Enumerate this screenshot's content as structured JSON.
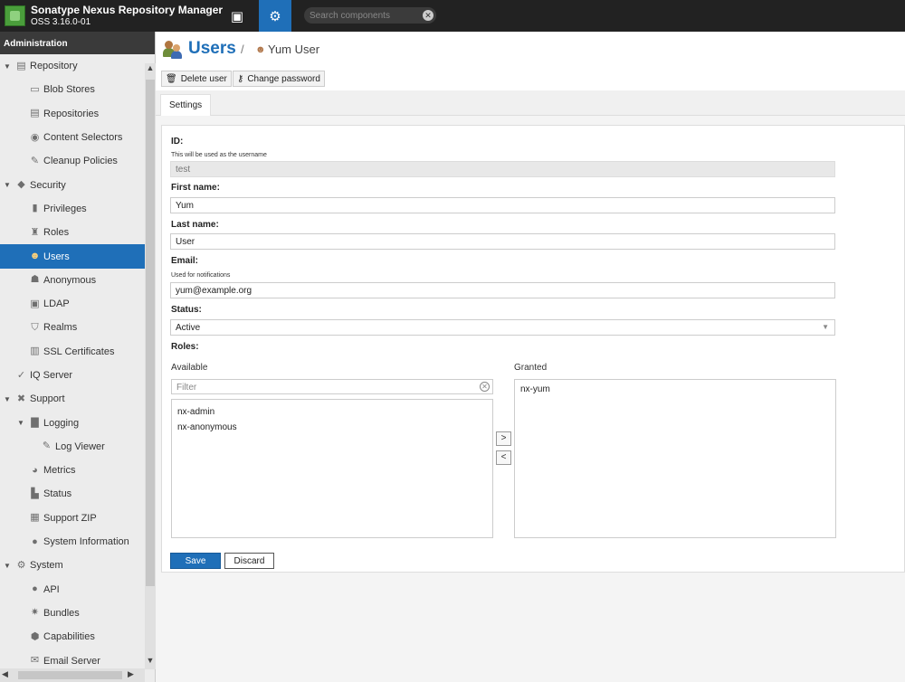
{
  "header": {
    "app_title": "Sonatype Nexus Repository Manager",
    "app_version": "OSS 3.16.0-01",
    "search_placeholder": "Search components",
    "search_clear": "✕"
  },
  "sidebar": {
    "title": "Administration",
    "items": [
      {
        "label": "Repository",
        "icon": "▤",
        "toggle": "▼"
      },
      {
        "label": "Blob Stores",
        "icon": "▭"
      },
      {
        "label": "Repositories",
        "icon": "▤"
      },
      {
        "label": "Content Selectors",
        "icon": "◉"
      },
      {
        "label": "Cleanup Policies",
        "icon": "✎"
      },
      {
        "label": "Security",
        "icon": "◆",
        "toggle": "▼"
      },
      {
        "label": "Privileges",
        "icon": "▮"
      },
      {
        "label": "Roles",
        "icon": "♜"
      },
      {
        "label": "Users",
        "icon": "☻"
      },
      {
        "label": "Anonymous",
        "icon": "☗"
      },
      {
        "label": "LDAP",
        "icon": "▣"
      },
      {
        "label": "Realms",
        "icon": "⛉"
      },
      {
        "label": "SSL Certificates",
        "icon": "▥"
      },
      {
        "label": "IQ Server",
        "icon": "✓"
      },
      {
        "label": "Support",
        "icon": "✖",
        "toggle": "▼"
      },
      {
        "label": "Logging",
        "icon": "▇",
        "toggle": "▼"
      },
      {
        "label": "Log Viewer",
        "icon": "✎"
      },
      {
        "label": "Metrics",
        "icon": "◕"
      },
      {
        "label": "Status",
        "icon": "▙"
      },
      {
        "label": "Support ZIP",
        "icon": "▦"
      },
      {
        "label": "System Information",
        "icon": "●"
      },
      {
        "label": "System",
        "icon": "⚙",
        "toggle": "▼"
      },
      {
        "label": "API",
        "icon": "●"
      },
      {
        "label": "Bundles",
        "icon": "✷"
      },
      {
        "label": "Capabilities",
        "icon": "⬢"
      },
      {
        "label": "Email Server",
        "icon": "✉"
      }
    ],
    "selected": "Users"
  },
  "page": {
    "title": "Users",
    "separator": "/",
    "breadcrumb_user": "Yum User"
  },
  "toolbar": {
    "delete_label": "Delete user",
    "change_password_label": "Change password"
  },
  "tabs": {
    "settings": "Settings"
  },
  "form": {
    "id_label": "ID:",
    "id_hint": "This will be used as the username",
    "id_value": "test",
    "first_name_label": "First name:",
    "first_name_value": "Yum",
    "last_name_label": "Last name:",
    "last_name_value": "User",
    "email_label": "Email:",
    "email_hint": "Used for notifications",
    "email_value": "yum@example.org",
    "status_label": "Status:",
    "status_value": "Active",
    "roles_label": "Roles:",
    "available_label": "Available",
    "granted_label": "Granted",
    "filter_placeholder": "Filter",
    "available_roles": [
      "nx-admin",
      "nx-anonymous"
    ],
    "granted_roles": [
      "nx-yum"
    ],
    "add_arrow": ">",
    "remove_arrow": "<",
    "save_label": "Save",
    "discard_label": "Discard"
  }
}
